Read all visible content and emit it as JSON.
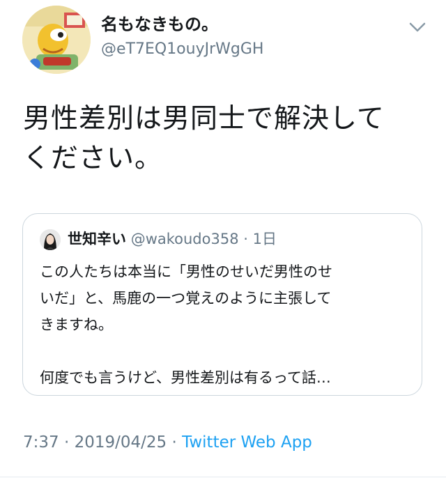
{
  "author": {
    "display_name": "名もなきもの。",
    "handle": "@eT7EQ1ouyJrWgGH"
  },
  "tweet": {
    "text_line1": "男性差別は男同士で解決して",
    "text_line2": "ください。"
  },
  "quoted_tweet": {
    "display_name": "世知辛い",
    "handle": "@wakoudo358",
    "separator": "·",
    "time": "1日",
    "lines": [
      "この人たちは本当に「男性のせいだ男性のせ",
      "いだ」と、馬鹿の一つ覚えのように主張して",
      "きますね。"
    ],
    "line_after_gap": "何度でも言うけど、男性差別は有るって話…"
  },
  "meta": {
    "time": "7:37",
    "separator": "·",
    "date": "2019/04/25",
    "client": "Twitter Web App"
  },
  "colors": {
    "text": "#14171a",
    "secondary": "#657786",
    "link": "#1da1f2",
    "border": "#ccd6dd"
  },
  "icons": {
    "caret": "chevron-down-icon"
  }
}
